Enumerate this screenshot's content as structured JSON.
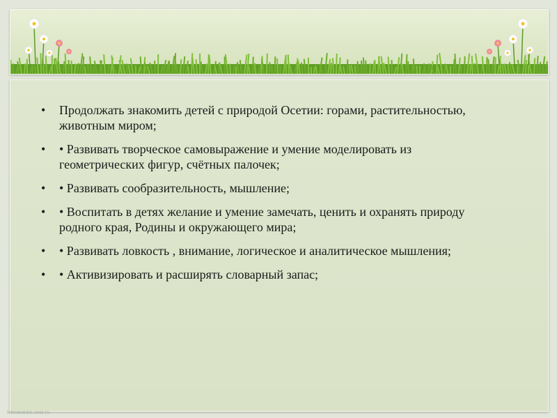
{
  "slide": {
    "bullet_symbol": "•",
    "items": [
      "Продолжать знакомить детей с природой Осетии: горами, растительностью, животным миром;",
      "• Развивать творческое самовыражение и умение моделировать из геометрических фигур, счётных палочек;",
      "• Развивать сообразительность, мышление;",
      "• Воспитать в детях желание и умение замечать, ценить и охранять природу родного края, Родины и окружающего мира;",
      "• Развивать ловкость , внимание, логическое и аналитическое мышления;",
      "• Активизировать и расширять словарный запас;"
    ],
    "watermark": "ielenaranko.ucoz.ru"
  },
  "colors": {
    "background": "#e3e6da",
    "panel": "#dde5cb",
    "grass": "#6fae2c",
    "text": "#1a1a1a"
  }
}
